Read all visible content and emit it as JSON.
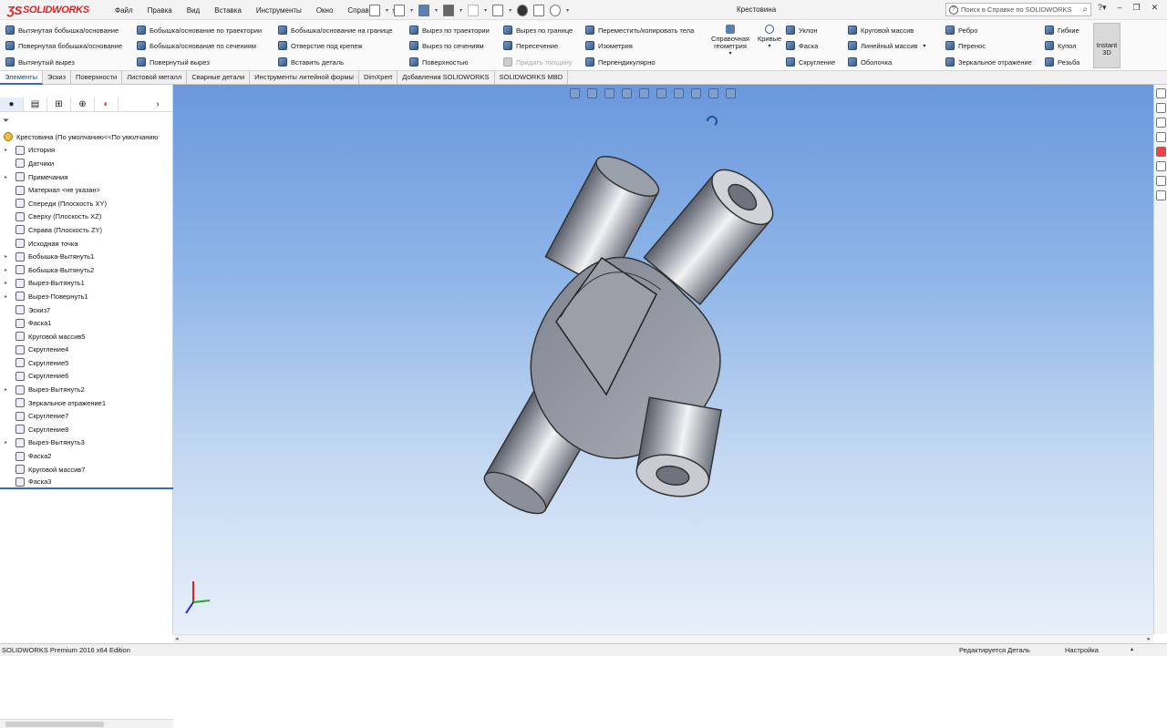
{
  "app": {
    "logo": "SOLIDWORKS",
    "document_title": "Крестовина"
  },
  "menu": [
    "Файл",
    "Правка",
    "Вид",
    "Вставка",
    "Инструменты",
    "Окно",
    "Справка"
  ],
  "search": {
    "placeholder": "Поиск в Справке по SOLIDWORKS"
  },
  "ribbon": {
    "col1": [
      "Вытянутая бобышка/основание",
      "Повернутая бобышка/основание",
      "Вытянутый вырез"
    ],
    "col2": [
      "Бобышка/основание по траектории",
      "Бобышка/основание по сечениям",
      "Повернутый вырез"
    ],
    "col3": [
      "Бобышка/основание на границе",
      "Отверстие под крепеж",
      "Вставить деталь"
    ],
    "col4": [
      "Вырез по траектории",
      "Вырез по сечениям",
      "Поверхностью"
    ],
    "col5": [
      "Вырез по границе",
      "Пересечение",
      "Придать толщину"
    ],
    "col6": [
      "Переместить/копировать тела",
      "Изометрия",
      "Перпендикулярно"
    ],
    "ref_geometry": "Справочная геометрия",
    "curves": "Кривые",
    "col7": [
      "Уклон",
      "Фаска",
      "Скругление"
    ],
    "col8": [
      "Круговой массив",
      "Линейный массив",
      "Оболочка"
    ],
    "col9": [
      "Ребро",
      "Перенос",
      "Зеркальное отражение"
    ],
    "col10": [
      "Гибкие",
      "Купол",
      "Резьба"
    ],
    "instant3d": "Instant 3D"
  },
  "tabs": [
    "Элементы",
    "Эскиз",
    "Поверхности",
    "Листовой металл",
    "Сварные детали",
    "Инструменты литейной формы",
    "DimXpert",
    "Добавления SOLIDWORKS",
    "SOLIDWORKS MBD"
  ],
  "tree": {
    "root": "Крестовина  (По умолчанию<<По умолчанию",
    "items": [
      {
        "label": "История",
        "expand": true
      },
      {
        "label": "Датчики",
        "expand": false
      },
      {
        "label": "Примечания",
        "expand": true
      },
      {
        "label": "Материал <не указан>",
        "expand": false
      },
      {
        "label": "Спереди (Плоскость XY)",
        "expand": false
      },
      {
        "label": "Сверху (Плоскость XZ)",
        "expand": false
      },
      {
        "label": "Справа (Плоскость ZY)",
        "expand": false
      },
      {
        "label": "Исходная точка",
        "expand": false
      },
      {
        "label": "Бобышка-Вытянуть1",
        "expand": true
      },
      {
        "label": "Бобышка-Вытянуть2",
        "expand": true
      },
      {
        "label": "Вырез-Вытянуть1",
        "expand": true
      },
      {
        "label": "Вырез-Повернуть1",
        "expand": true
      },
      {
        "label": "Эскиз7",
        "expand": false
      },
      {
        "label": "Фаска1",
        "expand": false
      },
      {
        "label": "Круговой массив5",
        "expand": false
      },
      {
        "label": "Скругление4",
        "expand": false
      },
      {
        "label": "Скругление5",
        "expand": false
      },
      {
        "label": "Скругление6",
        "expand": false
      },
      {
        "label": "Вырез-Вытянуть2",
        "expand": true
      },
      {
        "label": "Зеркальное отражение1",
        "expand": false
      },
      {
        "label": "Скругление7",
        "expand": false
      },
      {
        "label": "Скругление8",
        "expand": false
      },
      {
        "label": "Вырез-Вытянуть3",
        "expand": true
      },
      {
        "label": "Фаска2",
        "expand": false
      },
      {
        "label": "Круговой массив7",
        "expand": false
      },
      {
        "label": "Фаска3",
        "expand": false
      }
    ]
  },
  "status": {
    "left": "SOLIDWORKS Premium 2016 x64 Edition",
    "mid": "Редактируется Деталь",
    "right": "Настройка"
  },
  "colors": {
    "viewport_top": "#6a98dc",
    "viewport_bottom": "#e8f0fa",
    "part": "#8a8f99",
    "selection": "#3a68c8",
    "brand": "#d22222"
  }
}
